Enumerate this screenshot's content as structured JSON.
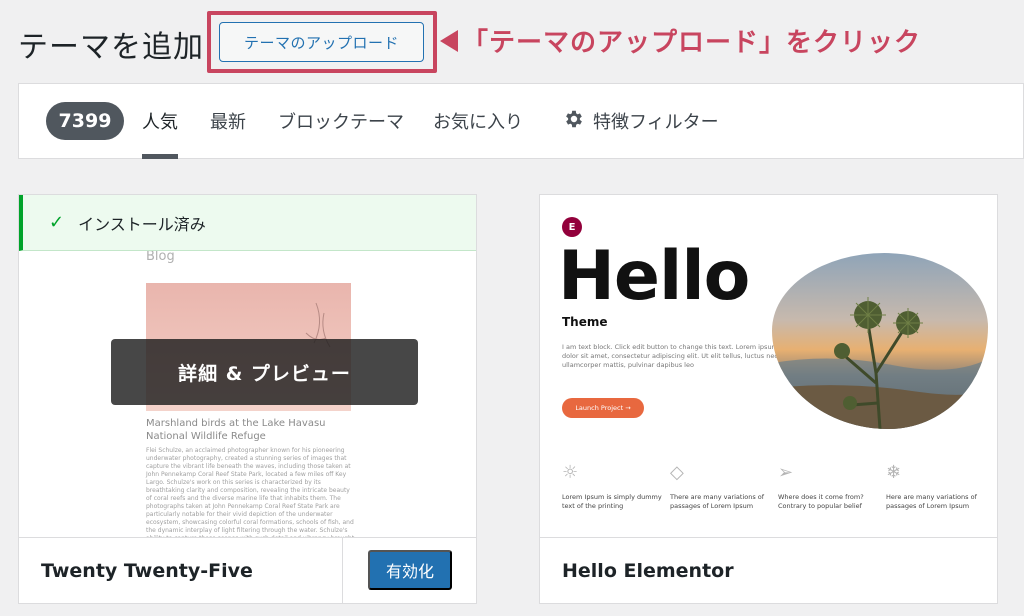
{
  "header": {
    "title": "テーマを追加",
    "upload_button": "テーマのアップロード",
    "callout": "「テーマのアップロード」をクリック"
  },
  "filter_bar": {
    "count": "7399",
    "tabs": [
      "人気",
      "最新",
      "ブロックテーマ",
      "お気に入り"
    ],
    "feature_filter": "特徴フィルター",
    "active_tab": "人気"
  },
  "themes": [
    {
      "name": "Twenty Twenty-Five",
      "installed_label": "インストール済み",
      "overlay_label": "詳細 & プレビュー",
      "action_label": "有効化",
      "screenshot": {
        "blog_label": "Blog",
        "caption": "Marshland birds at the Lake Havasu National Wildlife Refuge",
        "body": "Flei Schulze, an acclaimed photographer known for his pioneering underwater photography, created a stunning series of images that capture the vibrant life beneath the waves, including those taken at John Pennekamp Coral Reef State Park, located a few miles off Key Largo. Schulze's work on this series is characterized by its breathtaking clarity and composition, revealing the intricate beauty of coral reefs and the diverse marine life that inhabits them. The photographs taken at John Pennekamp Coral Reef State Park are particularly notable for their vivid depiction of the underwater ecosystem, showcasing colorful coral formations, schools of fish, and the dynamic interplay of light filtering through the water. Schulze's ability to capture these scenes with such detail and vibrancy brought the hidden wonders of the ocean to the public's eye, fostering a greater appreciation for marine conservation. His images not only highlight the aesthetic beauty of underwater environments but"
      }
    },
    {
      "name": "Hello Elementor",
      "screenshot": {
        "logo_letter": "E",
        "headline": "Hello",
        "subtitle": "Theme",
        "lorem": "I am text block. Click edit button to change this text. Lorem ipsum dolor sit amet, consectetur adipiscing elit. Ut elit tellus, luctus nec ullamcorper mattis, pulvinar dapibus leo",
        "launch_button": "Launch Project  →",
        "features": [
          {
            "icon": "lightbulb-icon",
            "text": "Lorem Ipsum is simply dummy text of the printing"
          },
          {
            "icon": "diamond-icon",
            "text": "There are many variations of passages of Lorem Ipsum"
          },
          {
            "icon": "paper-plane-icon",
            "text": "Where does it come from? Contrary to popular belief"
          },
          {
            "icon": "snowflake-icon",
            "text": "Here are many variations of passages of Lorem Ipsum"
          }
        ]
      }
    }
  ],
  "colors": {
    "accent": "#2271b1",
    "callout": "#c8455f",
    "installed": "#00a32a",
    "badge": "#50575e"
  }
}
